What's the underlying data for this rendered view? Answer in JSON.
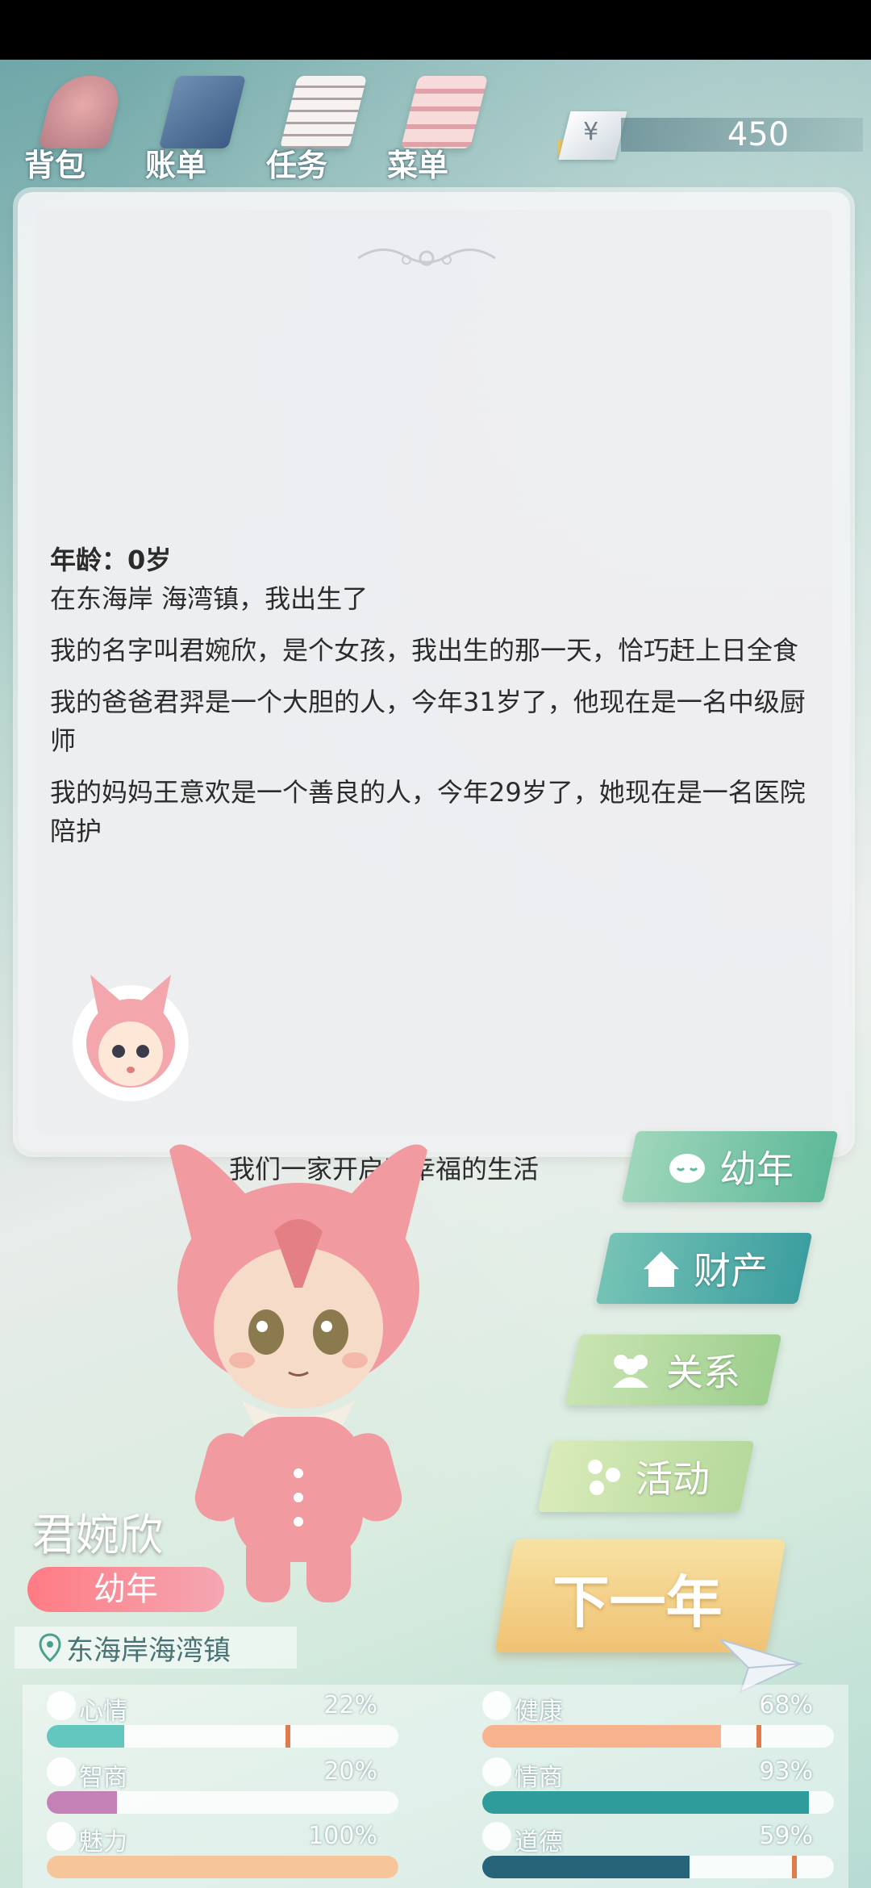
{
  "toolbar": {
    "bag": "背包",
    "bill": "账单",
    "task": "任务",
    "menu": "菜单",
    "currency_symbol": "¥",
    "money": "450"
  },
  "story": {
    "age": "年龄：0岁",
    "lines": [
      "在东海岸 海湾镇，我出生了",
      "我的名字叫君婉欣，是个女孩，我出生的那一天，恰巧赶上日全食",
      "我的爸爸君羿是一个大胆的人，今年31岁了，他现在是一名中级厨师",
      "我的妈妈王意欢是一个善良的人，今年29岁了，她现在是一名医院陪护"
    ],
    "family": "我们一家开启了幸福的生活"
  },
  "side_buttons": {
    "stage": "幼年",
    "assets": "财产",
    "relations": "关系",
    "activities": "活动",
    "next_year": "下一年"
  },
  "character": {
    "name": "君婉欣",
    "stage": "幼年",
    "location": "东海岸海湾镇"
  },
  "stats": [
    {
      "label": "心情",
      "value": "22%",
      "fraction": 0.22,
      "color": "#63c7c0",
      "marker": 0.68
    },
    {
      "label": "健康",
      "value": "68%",
      "fraction": 0.68,
      "color": "#f7b38e",
      "marker": 0.78
    },
    {
      "label": "智商",
      "value": "20%",
      "fraction": 0.2,
      "color": "#c381b6",
      "marker": null
    },
    {
      "label": "情商",
      "value": "93%",
      "fraction": 0.93,
      "color": "#2f9c9c",
      "marker": null
    },
    {
      "label": "魅力",
      "value": "100%",
      "fraction": 1.0,
      "color": "#f7c59a",
      "marker": null
    },
    {
      "label": "道德",
      "value": "59%",
      "fraction": 0.59,
      "color": "#27647a",
      "marker": 0.88
    }
  ]
}
